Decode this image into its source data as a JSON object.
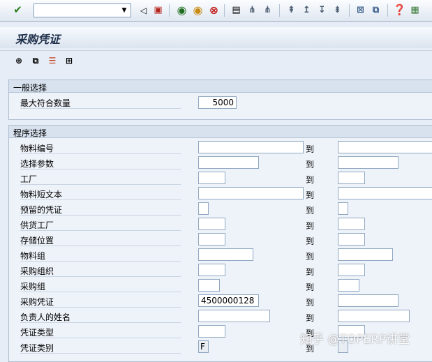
{
  "toolbar": {
    "command_field_value": "",
    "icons": [
      "enter-check-icon",
      "save-icon",
      "back-icon",
      "exit-icon",
      "cancel-icon",
      "print-icon",
      "find-icon",
      "find-next-icon",
      "first-page-icon",
      "previous-page-icon",
      "next-page-icon",
      "last-page-icon",
      "new-session-icon",
      "shortcut-icon",
      "help-icon",
      "layout-icon"
    ]
  },
  "title": "采购凭证",
  "app_toolbar": {
    "icons": [
      "execute-icon",
      "variant-icon",
      "selection-options-icon",
      "multiple-selection-icon"
    ]
  },
  "general_selection": {
    "header": "一般选择",
    "max_hits_label": "最大符合数量",
    "max_hits_value": "5000"
  },
  "program_selection": {
    "header": "程序选择",
    "to_label": "到",
    "rows": [
      {
        "label": "物料编号",
        "from": "",
        "to": ""
      },
      {
        "label": "选择参数",
        "from": "",
        "to": ""
      },
      {
        "label": "工厂",
        "from": "",
        "to": ""
      },
      {
        "label": "物料短文本",
        "from": "",
        "to": ""
      },
      {
        "label": "预留的凭证",
        "from": "",
        "to": ""
      },
      {
        "label": "供货工厂",
        "from": "",
        "to": ""
      },
      {
        "label": "存储位置",
        "from": "",
        "to": ""
      },
      {
        "label": "物料组",
        "from": "",
        "to": ""
      },
      {
        "label": "采购组织",
        "from": "",
        "to": ""
      },
      {
        "label": "采购组",
        "from": "",
        "to": ""
      },
      {
        "label": "采购凭证",
        "from": "4500000128",
        "to": ""
      },
      {
        "label": "负责人的姓名",
        "from": "",
        "to": ""
      },
      {
        "label": "凭证类型",
        "from": "",
        "to": ""
      },
      {
        "label": "凭证类别",
        "from": "F",
        "to": ""
      }
    ]
  },
  "watermark": "知乎 @TOPERP讲堂",
  "colors": {
    "background": "#e6edf6",
    "group_header": "#d8e2ee",
    "title_text": "#1e2f4a"
  }
}
